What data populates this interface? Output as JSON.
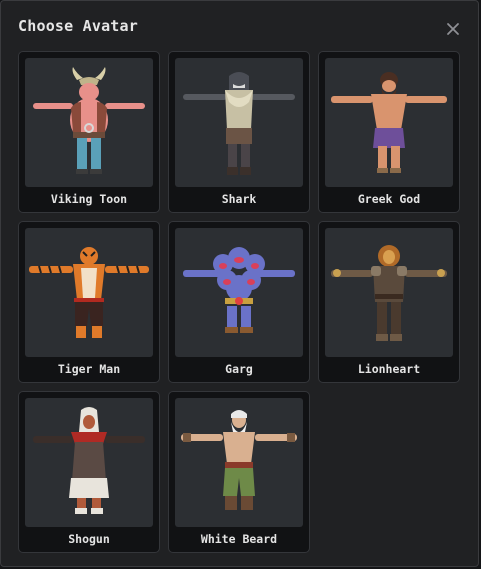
{
  "dialog": {
    "title": "Choose Avatar",
    "close_icon": "close-icon"
  },
  "avatars": [
    {
      "name": "Viking Toon",
      "figure": "viking-toon-figure"
    },
    {
      "name": "Shark",
      "figure": "shark-figure"
    },
    {
      "name": "Greek God",
      "figure": "greek-god-figure"
    },
    {
      "name": "Tiger Man",
      "figure": "tiger-man-figure"
    },
    {
      "name": "Garg",
      "figure": "garg-figure"
    },
    {
      "name": "Lionheart",
      "figure": "lionheart-figure"
    },
    {
      "name": "Shogun",
      "figure": "shogun-figure"
    },
    {
      "name": "White Beard",
      "figure": "white-beard-figure"
    }
  ],
  "colors": {
    "background": "#202123",
    "card": "#111214",
    "thumbnail": "#2c2f33",
    "text": "#e4e4e4"
  }
}
